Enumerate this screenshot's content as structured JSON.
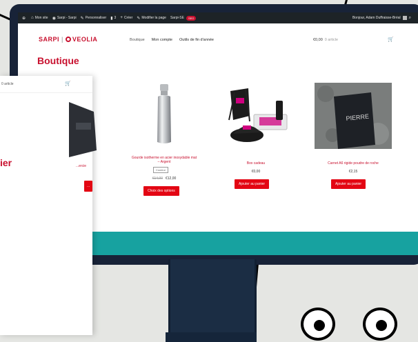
{
  "admin_bar": {
    "items": [
      "Mon site",
      "Sarpi - Sarpi",
      "Personnaliser",
      "3",
      "0",
      "Créer",
      "Modifier la page",
      "SEO",
      "Sarpi-SE"
    ],
    "seo_score": "SEO",
    "greeting": "Bonjour, Adam Duffraisse-Bréal"
  },
  "site": {
    "logo_left": "SARPI",
    "logo_right": "VEOLIA",
    "nav": [
      "Boutique",
      "Mon compte",
      "Outils de fin d'année"
    ],
    "cart_total": "€0,00",
    "cart_count": "0 article",
    "page_title": "Boutique"
  },
  "products": [
    {
      "name": "Gourde isotherme en acier inoxydable mat – Argent",
      "select_placeholder": "Couleur",
      "old_price": "€14,00",
      "price": "€12,00",
      "button": "Choix des options"
    },
    {
      "name": "Box cadeau",
      "price": "€0,00",
      "button": "Ajouter au panier"
    },
    {
      "name": "Carnet A6 rigide poudre de roche",
      "price": "€2,15",
      "button": "Ajouter au panier"
    },
    {
      "name": "...ercie",
      "button": "..."
    }
  ],
  "overlay": {
    "cart_count": "0 article",
    "title_fragment": "ier"
  },
  "colors": {
    "brand_red": "#c8102e",
    "button_red": "#e30613",
    "monitor_frame": "#182338",
    "monitor_chin": "#17a2a0",
    "admin_bar": "#1d2327"
  }
}
